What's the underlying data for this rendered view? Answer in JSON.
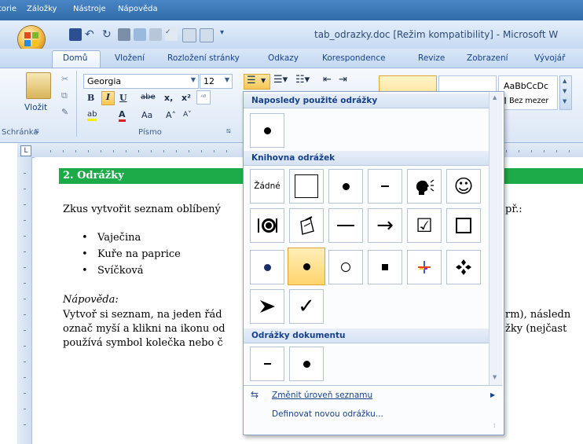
{
  "browser_menu": {
    "items": [
      "torie",
      "Záložky",
      "Nástroje",
      "Nápověda"
    ]
  },
  "titlebar": {
    "title": "tab_odrazky.doc [Režim kompatibility] - Microsoft W"
  },
  "ribbon_tabs": [
    "Domů",
    "Vložení",
    "Rozložení stránky",
    "Odkazy",
    "Korespondence",
    "Revize",
    "Zobrazení",
    "Vývojář"
  ],
  "ribbon": {
    "paste_label": "Vložit",
    "clipboard_label": "Schránka",
    "font_name": "Georgia",
    "font_size": "12",
    "font_group_label": "Písmo",
    "bold": "B",
    "italic": "I",
    "underline": "U",
    "strike": "abe",
    "subscript": "x,",
    "superscript": "x²",
    "text_effects": "ab",
    "font_color": "A",
    "change_case": "Aa",
    "grow_font": "A˄",
    "shrink_font": "A˅",
    "styles": [
      {
        "preview": "AaBbCcDc",
        "name": "¶ Bez mezer"
      }
    ]
  },
  "document": {
    "heading": "2. Odrážky",
    "intro_left": "Zkus vytvořit seznam oblíbený",
    "intro_right": "př.:",
    "list": [
      "Vaječina",
      "Kuře na paprice",
      "Svíčková"
    ],
    "help_title": "Nápověda:",
    "help_line1_left": "Vytvoř si seznam, na jeden řád",
    "help_line1_right": "rm), následn",
    "help_line2_left": "označ myší a klikni na ikonu od",
    "help_line2_right": "žky (nejčast",
    "help_line3_left": "používá symbol kolečka nebo č"
  },
  "bullet_panel": {
    "recent_title": "Naposledy použité odrážky",
    "library_title": "Knihovna odrážek",
    "document_title": "Odrážky dokumentu",
    "none_label": "Žádné",
    "change_level": "Změnit úroveň seznamu",
    "define_new": "Definovat novou odrážku...",
    "selected_cell": "bullet-dot-medium",
    "accent_color": "#1dab4a"
  }
}
